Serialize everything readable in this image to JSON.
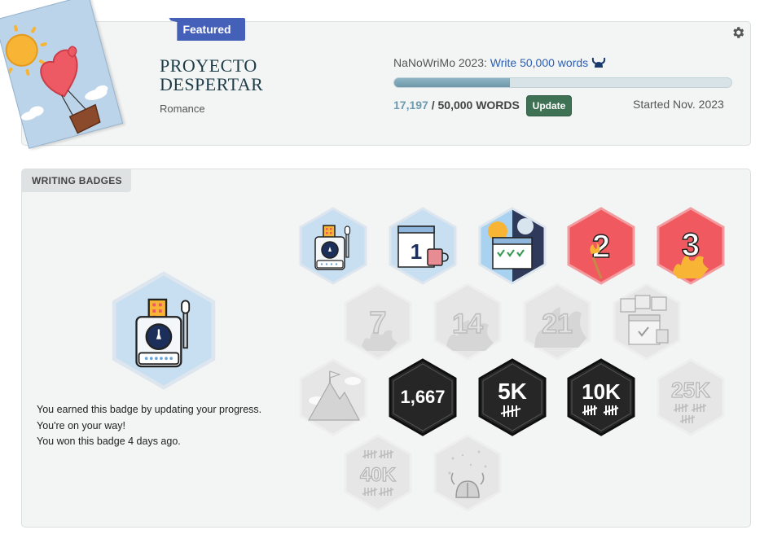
{
  "project": {
    "featured_label": "Featured",
    "title_line1": "PROYECTO",
    "title_line2": "DESPERTAR",
    "genre": "Romance",
    "challenge_prefix": "NaNoWriMo 2023:",
    "challenge_goal": "Write 50,000 words",
    "current_words": "17,197",
    "goal_words": "/ 50,000 WORDS",
    "progress_fraction": 0.344,
    "update_label": "Update",
    "started": "Started Nov. 2023",
    "settings_icon": "gear-icon",
    "cover_icons": [
      "sun-icon",
      "heart-balloon-icon",
      "cloud-icon"
    ]
  },
  "badges_panel": {
    "tab_label": "WRITING BADGES",
    "selected_badge": "slot-machine-badge",
    "description": [
      "You earned this badge by updating your progress.",
      "You're on your way!",
      "You won this badge 4 days ago."
    ],
    "badges": [
      {
        "name": "slot-machine-badge",
        "earned": true,
        "text": ""
      },
      {
        "name": "first-day-badge",
        "earned": true,
        "text": "1"
      },
      {
        "name": "calendar-checks-badge",
        "earned": true,
        "text": ""
      },
      {
        "name": "streak-2-badge",
        "earned": true,
        "text": "2"
      },
      {
        "name": "streak-3-badge",
        "earned": true,
        "text": "3"
      },
      {
        "name": "streak-7-badge",
        "earned": false,
        "text": "7"
      },
      {
        "name": "streak-14-badge",
        "earned": false,
        "text": "14"
      },
      {
        "name": "streak-21-badge",
        "earned": false,
        "text": "21"
      },
      {
        "name": "calendar-dates-badge",
        "earned": false,
        "text": ""
      },
      {
        "name": "mountain-badge",
        "earned": false,
        "text": ""
      },
      {
        "name": "words-1667-badge",
        "earned": true,
        "text": "1,667"
      },
      {
        "name": "words-5k-badge",
        "earned": true,
        "text": "5K"
      },
      {
        "name": "words-10k-badge",
        "earned": true,
        "text": "10K"
      },
      {
        "name": "words-25k-badge",
        "earned": false,
        "text": "25K"
      },
      {
        "name": "words-40k-badge",
        "earned": false,
        "text": "40K"
      },
      {
        "name": "viking-helmet-badge",
        "earned": false,
        "text": ""
      }
    ]
  },
  "colors": {
    "featured": "#4560b8",
    "update_button": "#3f7154",
    "progress": "#7ea7b7",
    "streak_red": "#f0595f",
    "dark_badge": "#262626",
    "locked_badge": "#e6e6e6",
    "light_blue_badge": "#c8dff2"
  }
}
